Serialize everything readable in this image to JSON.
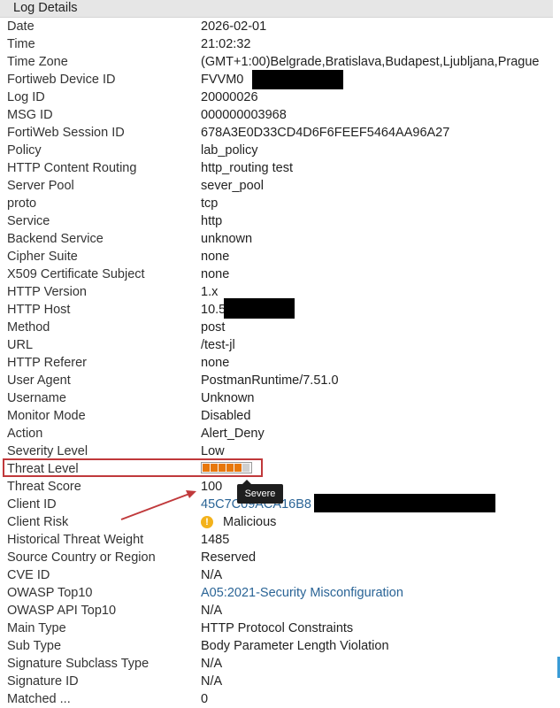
{
  "header": {
    "title": "Log Details"
  },
  "colors": {
    "link": "#2a6496",
    "threat_bar": "#e8770c",
    "highlight_box": "#c0393b",
    "warning": "#f3b21b"
  },
  "rows": [
    {
      "label": "Date",
      "value": "2026-02-01"
    },
    {
      "label": "Time",
      "value": "21:02:32"
    },
    {
      "label": "Time Zone",
      "value": "(GMT+1:00)Belgrade,Bratislava,Budapest,Ljubljana,Prague"
    },
    {
      "label": "Fortiweb Device ID",
      "value": "FVVM0"
    },
    {
      "label": "Log ID",
      "value": "20000026"
    },
    {
      "label": "MSG ID",
      "value": "000000003968"
    },
    {
      "label": "FortiWeb Session ID",
      "value": "678A3E0D33CD4D6F6FEEF5464AA96A27"
    },
    {
      "label": "Policy",
      "value": "lab_policy"
    },
    {
      "label": "HTTP Content Routing",
      "value": "http_routing test"
    },
    {
      "label": "Server Pool",
      "value": "sever_pool"
    },
    {
      "label": "proto",
      "value": "tcp"
    },
    {
      "label": "Service",
      "value": "http"
    },
    {
      "label": "Backend Service",
      "value": "unknown"
    },
    {
      "label": "Cipher Suite",
      "value": "none"
    },
    {
      "label": "X509 Certificate Subject",
      "value": "none"
    },
    {
      "label": "HTTP Version",
      "value": "1.x"
    },
    {
      "label": "HTTP Host",
      "value": "10.5"
    },
    {
      "label": "Method",
      "value": "post"
    },
    {
      "label": "URL",
      "value": "/test-jl"
    },
    {
      "label": "HTTP Referer",
      "value": "none"
    },
    {
      "label": "User Agent",
      "value": "PostmanRuntime/7.51.0"
    },
    {
      "label": "Username",
      "value": "Unknown"
    },
    {
      "label": "Monitor Mode",
      "value": "Disabled"
    },
    {
      "label": "Action",
      "value": "Alert_Deny"
    },
    {
      "label": "Severity Level",
      "value": "Low"
    },
    {
      "label": "Threat Level",
      "value": ""
    },
    {
      "label": "Threat Score",
      "value": "100"
    },
    {
      "label": "Client ID",
      "value": "45C7C09ACA16B8"
    },
    {
      "label": "Client Risk",
      "value": "Malicious"
    },
    {
      "label": "Historical Threat Weight",
      "value": "1485"
    },
    {
      "label": "Source Country or Region",
      "value": "Reserved"
    },
    {
      "label": "CVE ID",
      "value": "N/A"
    },
    {
      "label": "OWASP Top10",
      "value": "A05:2021-Security Misconfiguration"
    },
    {
      "label": "OWASP API Top10",
      "value": "N/A"
    },
    {
      "label": "Main Type",
      "value": "HTTP Protocol Constraints"
    },
    {
      "label": "Sub Type",
      "value": "Body Parameter Length Violation"
    },
    {
      "label": "Signature Subclass Type",
      "value": "N/A"
    },
    {
      "label": "Signature ID",
      "value": "N/A"
    },
    {
      "label": "Matched ...",
      "value": "0"
    }
  ],
  "threat_level": {
    "level": 5,
    "max": 6,
    "tooltip": "Severe"
  },
  "client_risk_icon": "warning-icon"
}
